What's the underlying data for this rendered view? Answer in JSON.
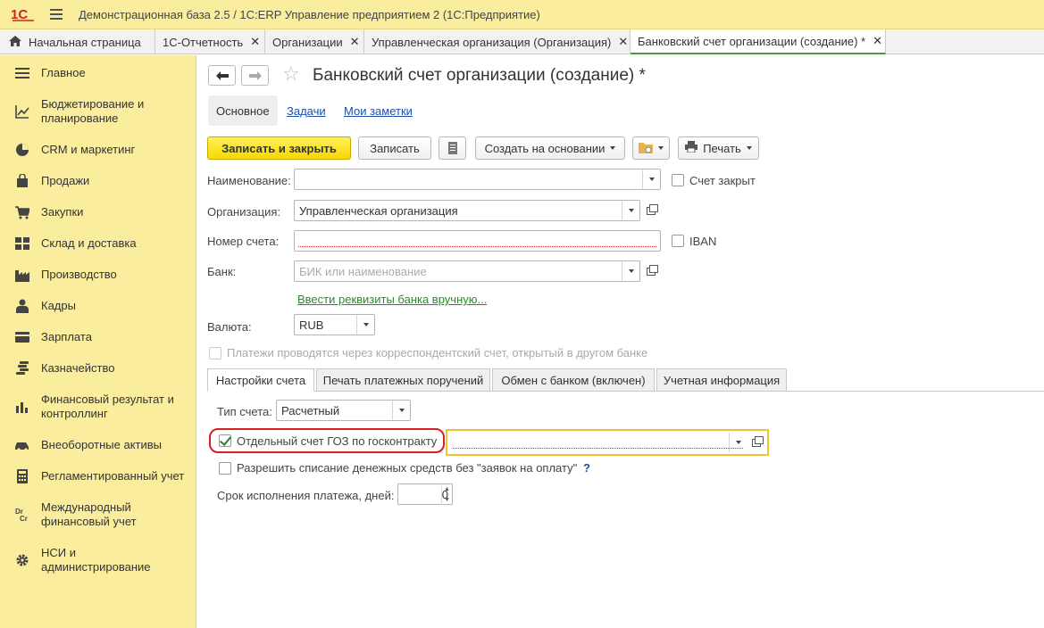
{
  "app": {
    "title": "Демонстрационная база 2.5 / 1С:ERP Управление предприятием 2  (1С:Предприятие)"
  },
  "tabs": [
    {
      "label": "Начальная страница"
    },
    {
      "label": "1С-Отчетность"
    },
    {
      "label": "Организации"
    },
    {
      "label": "Управленческая организация (Организация)"
    },
    {
      "label": "Банковский счет организации (создание) *"
    }
  ],
  "sidebar": {
    "items": [
      {
        "label": "Главное",
        "icon": "menu-lines-icon"
      },
      {
        "label": "Бюджетирование и планирование",
        "icon": "budget-chart-icon"
      },
      {
        "label": "CRM и маркетинг",
        "icon": "pie-chart-icon"
      },
      {
        "label": "Продажи",
        "icon": "shopping-bag-icon"
      },
      {
        "label": "Закупки",
        "icon": "cart-icon"
      },
      {
        "label": "Склад и доставка",
        "icon": "warehouse-grid-icon"
      },
      {
        "label": "Производство",
        "icon": "factory-icon"
      },
      {
        "label": "Кадры",
        "icon": "person-icon"
      },
      {
        "label": "Зарплата",
        "icon": "wallet-icon"
      },
      {
        "label": "Казначейство",
        "icon": "coins-icon"
      },
      {
        "label": "Финансовый результат и контроллинг",
        "icon": "bar-chart-icon"
      },
      {
        "label": "Внеоборотные активы",
        "icon": "car-icon"
      },
      {
        "label": "Регламентированный учет",
        "icon": "calculator-icon"
      },
      {
        "label": "Международный финансовый учет",
        "icon": "dr-cr-icon"
      },
      {
        "label": "НСИ и администрирование",
        "icon": "gear-icon"
      }
    ]
  },
  "form": {
    "title": "Банковский счет организации (создание) *",
    "sections": [
      "Основное",
      "Задачи",
      "Мои заметки"
    ],
    "toolbar": {
      "save_close": "Записать и закрыть",
      "save": "Записать",
      "create_based": "Создать на основании",
      "print": "Печать"
    },
    "fields": {
      "name_label": "Наименование:",
      "name_value": "",
      "closed_label": "Счет закрыт",
      "org_label": "Организация:",
      "org_value": "Управленческая организация",
      "account_label": "Номер счета:",
      "account_value": "",
      "iban_label": "IBAN",
      "bank_label": "Банк:",
      "bank_placeholder": "БИК или наименование",
      "bank_manual_link": "Ввести реквизиты банка вручную...",
      "currency_label": "Валюта:",
      "currency_value": "RUB",
      "corr_label": "Платежи проводятся через корреспондентский счет, открытый в другом банке"
    },
    "pages": [
      "Настройки счета",
      "Печать платежных поручений",
      "Обмен с банком (включен)",
      "Учетная информация"
    ],
    "settings": {
      "type_label": "Тип счета:",
      "type_value": "Расчетный",
      "goz_label": "Отдельный счет ГОЗ по госконтракту",
      "goz_checked": true,
      "goz_contract_value": "",
      "allow_label": "Разрешить списание денежных средств без \"заявок на оплату\"",
      "allow_help": "?",
      "term_label": "Срок исполнения платежа, дней:",
      "term_value": "0"
    }
  },
  "colors": {
    "accent_yellow": "#fbed9e",
    "primary_button": "#f7d800",
    "active_tab_underline": "#4d9b3f",
    "link_blue": "#1c4fa8",
    "link_green": "#2b8a2b",
    "highlight_red": "#d42020",
    "highlight_yellow": "#f1c232"
  }
}
